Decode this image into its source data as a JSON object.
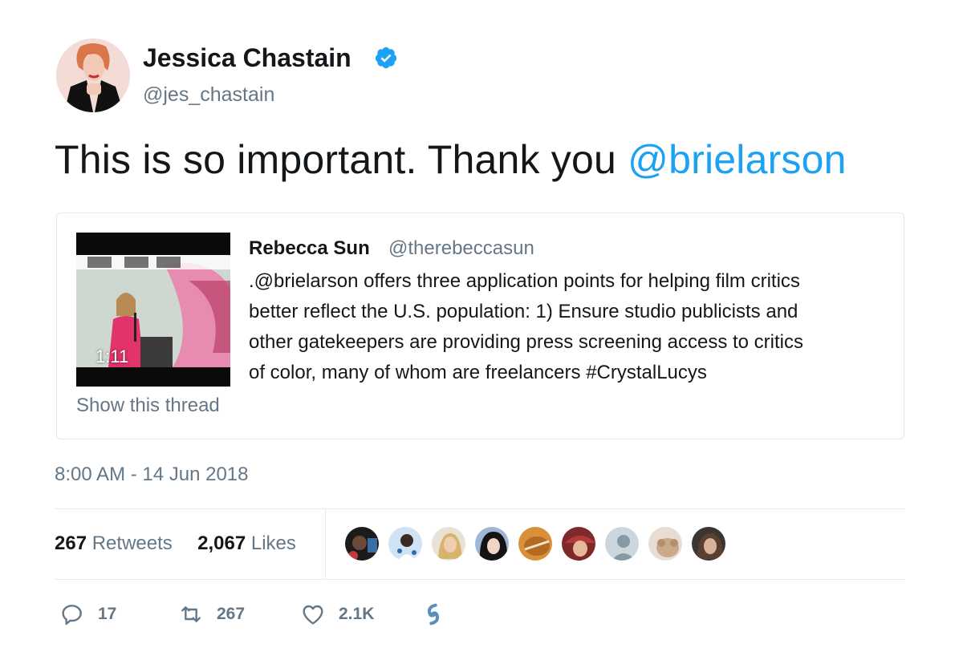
{
  "author": {
    "name": "Jessica Chastain",
    "handle": "@jes_chastain",
    "verified_icon": "verified-badge-icon",
    "avatar_icon": "profile-photo"
  },
  "tweet": {
    "text_prefix": "This is so important. Thank you ",
    "mention": "@brielarson"
  },
  "quoted_tweet": {
    "name": "Rebecca Sun",
    "handle": "@therebeccasun",
    "text_lines": [
      ".@brielarson offers three application points for helping film critics",
      "better reflect the U.S. population: 1) Ensure studio publicists and",
      "other gatekeepers are providing press screening access to critics",
      "of color, many of whom are freelancers #CrystalLucys"
    ],
    "video_duration": "1:11",
    "show_thread": "Show this thread"
  },
  "timestamp": "8:00 AM - 14 Jun 2018",
  "stats": {
    "retweets_count": "267",
    "retweets_label": "Retweets",
    "likes_count": "2,067",
    "likes_label": "Likes"
  },
  "actions": {
    "reply_count": "17",
    "retweet_count": "267",
    "like_count": "2.1K"
  },
  "colors": {
    "link": "#1da1f2",
    "secondary_text": "#657786",
    "primary_text": "#14171a",
    "border": "#e1e8ed"
  }
}
